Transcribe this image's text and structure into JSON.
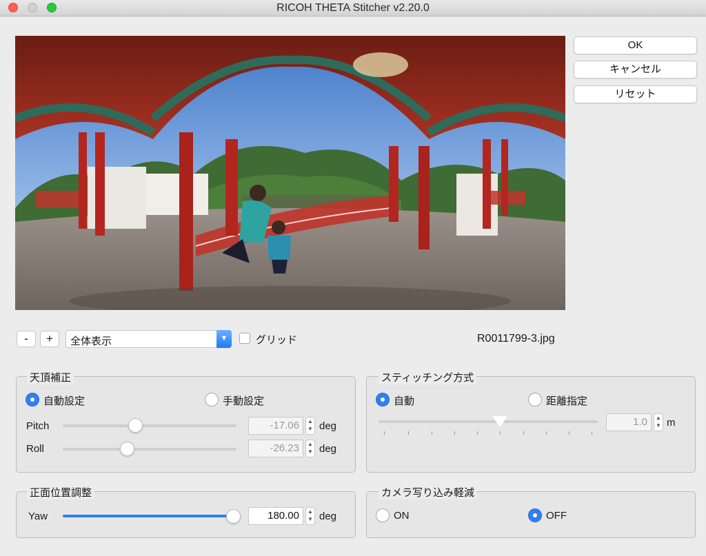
{
  "window": {
    "title": "RICOH THETA Stitcher v2.20.0"
  },
  "buttons": {
    "ok": "OK",
    "cancel": "キャンセル",
    "reset": "リセット"
  },
  "toolbar": {
    "zoom_out": "-",
    "zoom_in": "+",
    "view_select": "全体表示",
    "grid_label": "グリッド",
    "grid_checked": false,
    "filename": "R0011799-3.jpg"
  },
  "zenith": {
    "title": "天頂補正",
    "auto_label": "自動設定",
    "manual_label": "手動設定",
    "selected": "auto",
    "pitch": {
      "label": "Pitch",
      "value": "-17.06",
      "unit": "deg",
      "slider": 0.34
    },
    "roll": {
      "label": "Roll",
      "value": "-26.23",
      "unit": "deg",
      "slider": 0.3
    }
  },
  "stitching": {
    "title": "スティッチング方式",
    "auto_label": "自動",
    "distance_label": "距離指定",
    "selected": "auto",
    "distance": {
      "value": "1.0",
      "unit": "m",
      "slider": 0.56
    }
  },
  "front": {
    "title": "正面位置調整",
    "yaw": {
      "label": "Yaw",
      "value": "180.00",
      "unit": "deg",
      "slider": 1.0
    }
  },
  "camera_reduction": {
    "title": "カメラ写り込み軽減",
    "on_label": "ON",
    "off_label": "OFF",
    "selected": "off"
  },
  "colors": {
    "accent": "#2f7ff3",
    "close": "#fc5f57",
    "maximize": "#2ac840"
  }
}
